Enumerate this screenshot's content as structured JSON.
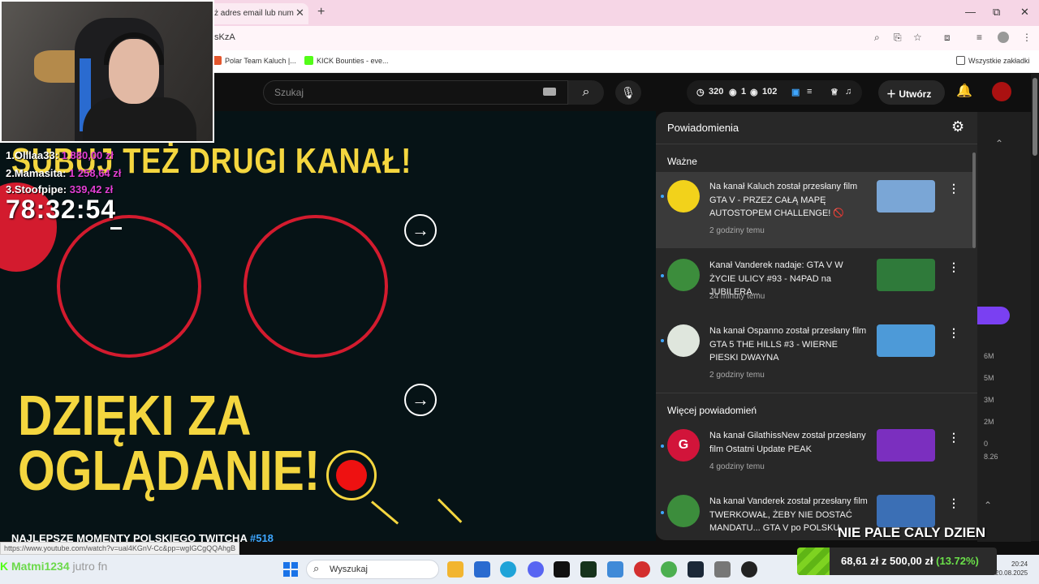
{
  "browser": {
    "tab_title": "ż adres email lub num",
    "url": "sKzA",
    "bookmarks": [
      {
        "label": "Polar Team Kaluch |...",
        "color": "#e4572e"
      },
      {
        "label": "KICK Bounties - eve...",
        "color": "#53fc18"
      }
    ],
    "all_bookmarks_label": "Wszystkie zakładki"
  },
  "youtube": {
    "search_placeholder": "Szukaj",
    "stats": {
      "subs": "320",
      "live": "1",
      "views": "102"
    },
    "create_label": "Utwórz"
  },
  "stream": {
    "top_donors": [
      {
        "rank_name": "1.Olllaa33:",
        "amount": "1 880,00 zł"
      },
      {
        "rank_name": "2.Mamasita:",
        "amount": "1 258,64 zł"
      },
      {
        "rank_name": "3.Stoofpipe:",
        "amount": "339,42 zł"
      }
    ],
    "timer": "78:32:54",
    "banner_top": "SUBUJ TEŻ DRUGI KANAŁ!",
    "thanks_line1": "DZIĘKI ZA",
    "thanks_line2": "OGLĄDANIE!",
    "caption": "NAJLEPSZE MOMENTY POLSKIEGO TWITCHA",
    "caption_number": "#518",
    "chat_user": "Matmi1234",
    "chat_msg": "jutro fn",
    "overlay_text": "NIE PALE CALY DZIEN",
    "donation": {
      "collected": "68,61 zł",
      "separator": "z",
      "goal": "500,00 zł",
      "percent": "(13.72%)",
      "progress": 0.1372
    }
  },
  "notifications": {
    "title": "Powiadomienia",
    "important_label": "Ważne",
    "more_label": "Więcej powiadomień",
    "items": [
      {
        "text": "Na kanał Kaluch został przesłany film GTA V - PRZEZ CAŁĄ MAPĘ AUTOSTOPEM CHALLENGE! 🚫",
        "time": "2 godziny temu",
        "avatar_color": "#f2d21b",
        "thumb_color": "#7aa6d6"
      },
      {
        "text": "Kanał Vanderek nadaje: GTA V W ŻYCIE ULICY #93 - N4PAD na JUBILERA...",
        "time": "24 minuty temu",
        "avatar_color": "#3c8d3c",
        "thumb_color": "#2f7a3a"
      },
      {
        "text": "Na kanał Ospanno został przesłany film GTA 5 THE HILLS #3 - WIERNE PIESKI DWAYNA",
        "time": "2 godziny temu",
        "avatar_color": "#dfe6dd",
        "thumb_color": "#4d9ad8"
      },
      {
        "text": "Na kanał GilathissNew został przesłany film Ostatni Update PEAK",
        "time": "4 godziny temu",
        "avatar_color": "#d2143a",
        "thumb_color": "#7b2fbf",
        "avatar_letter": "G"
      },
      {
        "text": "Na kanał Vanderek został przesłany film TWERKOWAŁ, ŻEBY NIE DOSTAĆ MANDATU... GTA V po POLSKU",
        "time": "",
        "avatar_color": "#3c8d3c",
        "thumb_color": "#3b6fb5"
      }
    ]
  },
  "studio_side": {
    "labels": [
      "6M",
      "5M",
      "3M",
      "2M",
      "0",
      "8.26"
    ]
  },
  "status_url": "https://www.youtube.com/watch?v=ual4KGnV-Cc&pp=wgIGCgQQAhgB",
  "taskbar": {
    "search_label": "Wyszukaj",
    "clock_time": "20:24",
    "clock_date": "20.08.2025"
  }
}
